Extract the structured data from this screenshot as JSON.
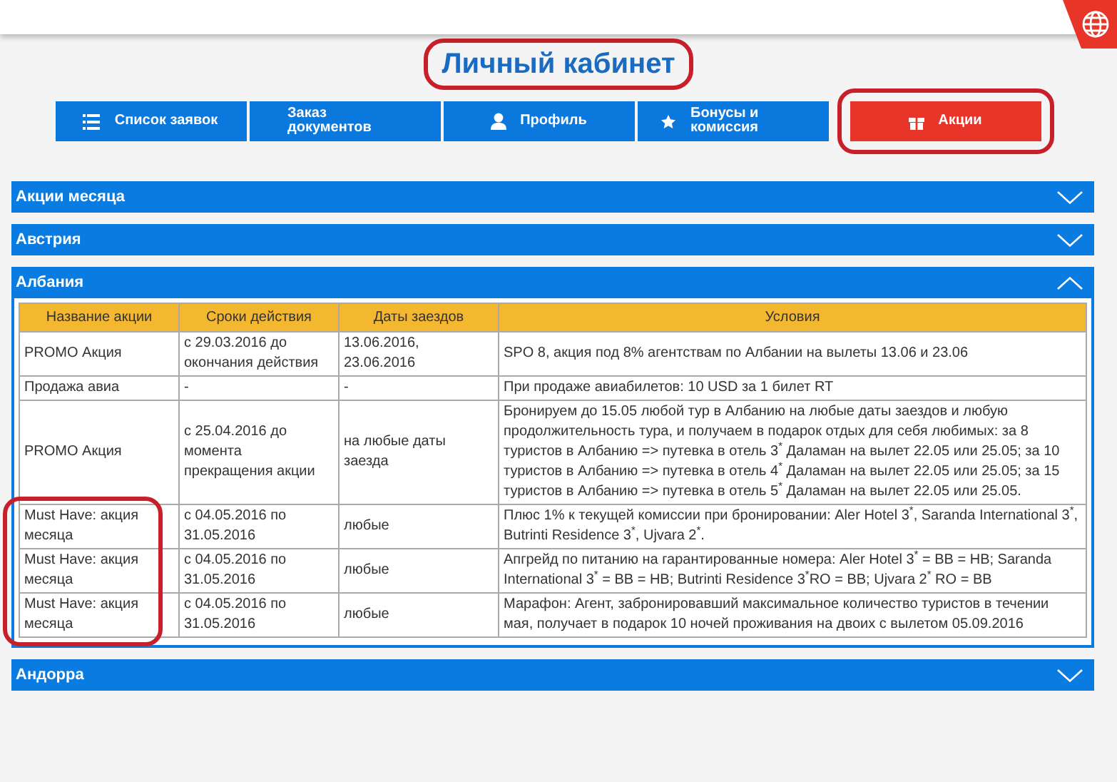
{
  "page_title": "Личный кабинет",
  "tabs": [
    {
      "label": "Список заявок",
      "selected": false
    },
    {
      "label": "Заказ документов",
      "selected": false
    },
    {
      "label": "Профиль",
      "selected": false
    },
    {
      "label": "Бонусы и комиссия",
      "selected": false
    },
    {
      "label": "Акции",
      "selected": true
    }
  ],
  "sections": [
    {
      "title": "Акции месяца",
      "expanded": false
    },
    {
      "title": "Австрия",
      "expanded": false
    },
    {
      "title": "Албания",
      "expanded": true,
      "table": {
        "columns": [
          "Название акции",
          "Сроки действия",
          "Даты заездов",
          "Условия"
        ],
        "rows": [
          [
            "PROMO Акция",
            "с 29.03.2016 до окончания действия",
            "13.06.2016, 23.06.2016",
            "SPO 8, акция под 8% агентствам по Албании на вылеты 13.06 и 23.06"
          ],
          [
            "Продажа авиа",
            "-",
            "-",
            "При продаже авиабилетов: 10 USD за 1 билет RT"
          ],
          [
            "PROMO Акция",
            "с 25.04.2016 до момента прекращения акции",
            "на любые даты заезда",
            "Бронируем до 15.05 любой тур в Албанию на любые даты заездов и любую продолжительность тура, и получаем в подарок отдых для себя любимых: за 8 туристов в Албанию => путевка в отель 3$^{*}$ Даламан на вылет 22.05 или 25.05; за 10 туристов в Албанию => путевка в отель 4$^{*}$ Даламан на вылет 22.05 или 25.05; за 15 туристов в Албанию => путевка в отель 5$^{*}$ Даламан на вылет 22.05 или 25.05."
          ],
          [
            "Must Have: акция месяца",
            "с 04.05.2016 по 31.05.2016",
            "любые",
            "Плюс 1% к текущей комиссии при бронировании: Aler Hotel 3$^{*}$, Saranda International 3$^{*}$, Butrinti Residence 3$^{*}$, Ujvara 2$^{*}$."
          ],
          [
            "Must Have: акция месяца",
            "с 04.05.2016 по 31.05.2016",
            "любые",
            "Апгрейд по питанию на гарантированные номера: Aler Hotel 3$^{*}$ = BB = HB; Saranda International 3$^{*}$ = BB = HB; Butrinti Residence 3$^{*}$RO = BB; Ujvara 2$^{*}$ RO = BB"
          ],
          [
            "Must Have: акция месяца",
            "с 04.05.2016 по 31.05.2016",
            "любые",
            "Марафон: Агент, забронировавший максимальное количество туристов в течении мая, получает в подарок 10 ночей проживания на двоих с вылетом 05.09.2016"
          ]
        ]
      }
    },
    {
      "title": "Андорра",
      "expanded": false
    }
  ]
}
